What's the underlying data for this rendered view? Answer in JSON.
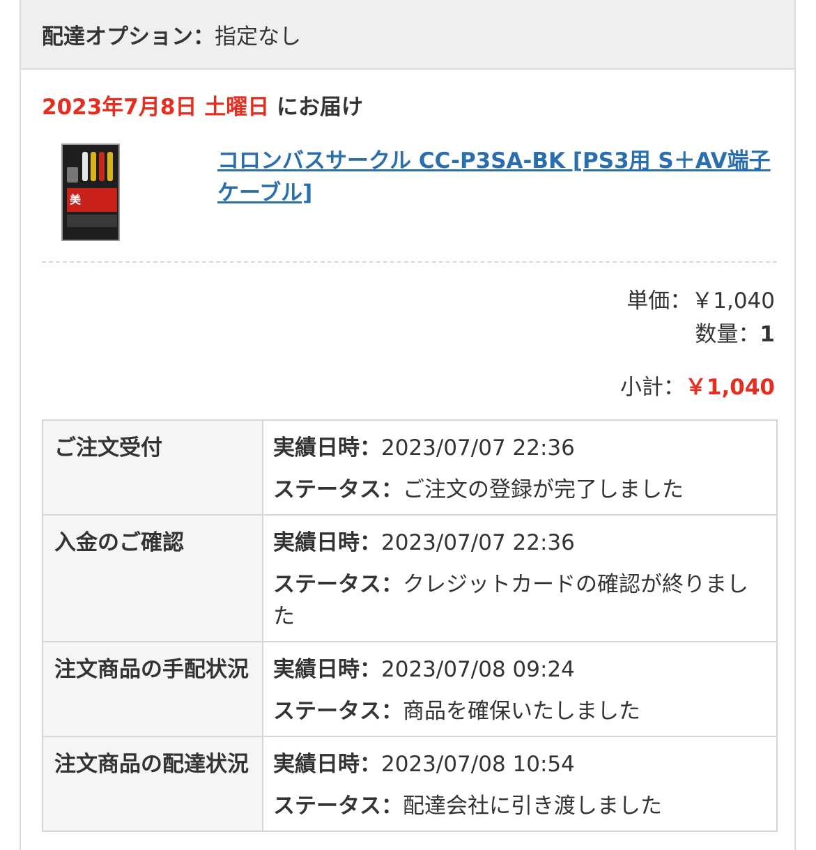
{
  "delivery_option": {
    "label": "配達オプション：",
    "value": "指定なし"
  },
  "delivery_date": {
    "date": "2023年7月8日 土曜日",
    "suffix": "にお届け"
  },
  "product": {
    "title": "コロンバスサークル CC-P3SA-BK [PS3用 S＋AV端子ケーブル]",
    "thumb_text": "美"
  },
  "pricing": {
    "unit_label": "単価：",
    "unit_value": "￥1,040",
    "qty_label": "数量：",
    "qty_value": "1",
    "subtotal_label": "小計：",
    "subtotal_value": "￥1,040"
  },
  "status_rows": [
    {
      "step": "ご注文受付",
      "date_label": "実績日時：",
      "date": "2023/07/07 22:36",
      "status_label": "ステータス：",
      "status": "ご注文の登録が完了しました"
    },
    {
      "step": "入金のご確認",
      "date_label": "実績日時：",
      "date": "2023/07/07 22:36",
      "status_label": "ステータス：",
      "status": "クレジットカードの確認が終りました"
    },
    {
      "step": "注文商品の手配状況",
      "date_label": "実績日時：",
      "date": "2023/07/08 09:24",
      "status_label": "ステータス：",
      "status": "商品を確保いたしました"
    },
    {
      "step": "注文商品の配達状況",
      "date_label": "実績日時：",
      "date": "2023/07/08 10:54",
      "status_label": "ステータス：",
      "status": "配達会社に引き渡しました"
    }
  ],
  "colors": {
    "accent_red": "#e52d20",
    "link_blue": "#2a6fad"
  }
}
